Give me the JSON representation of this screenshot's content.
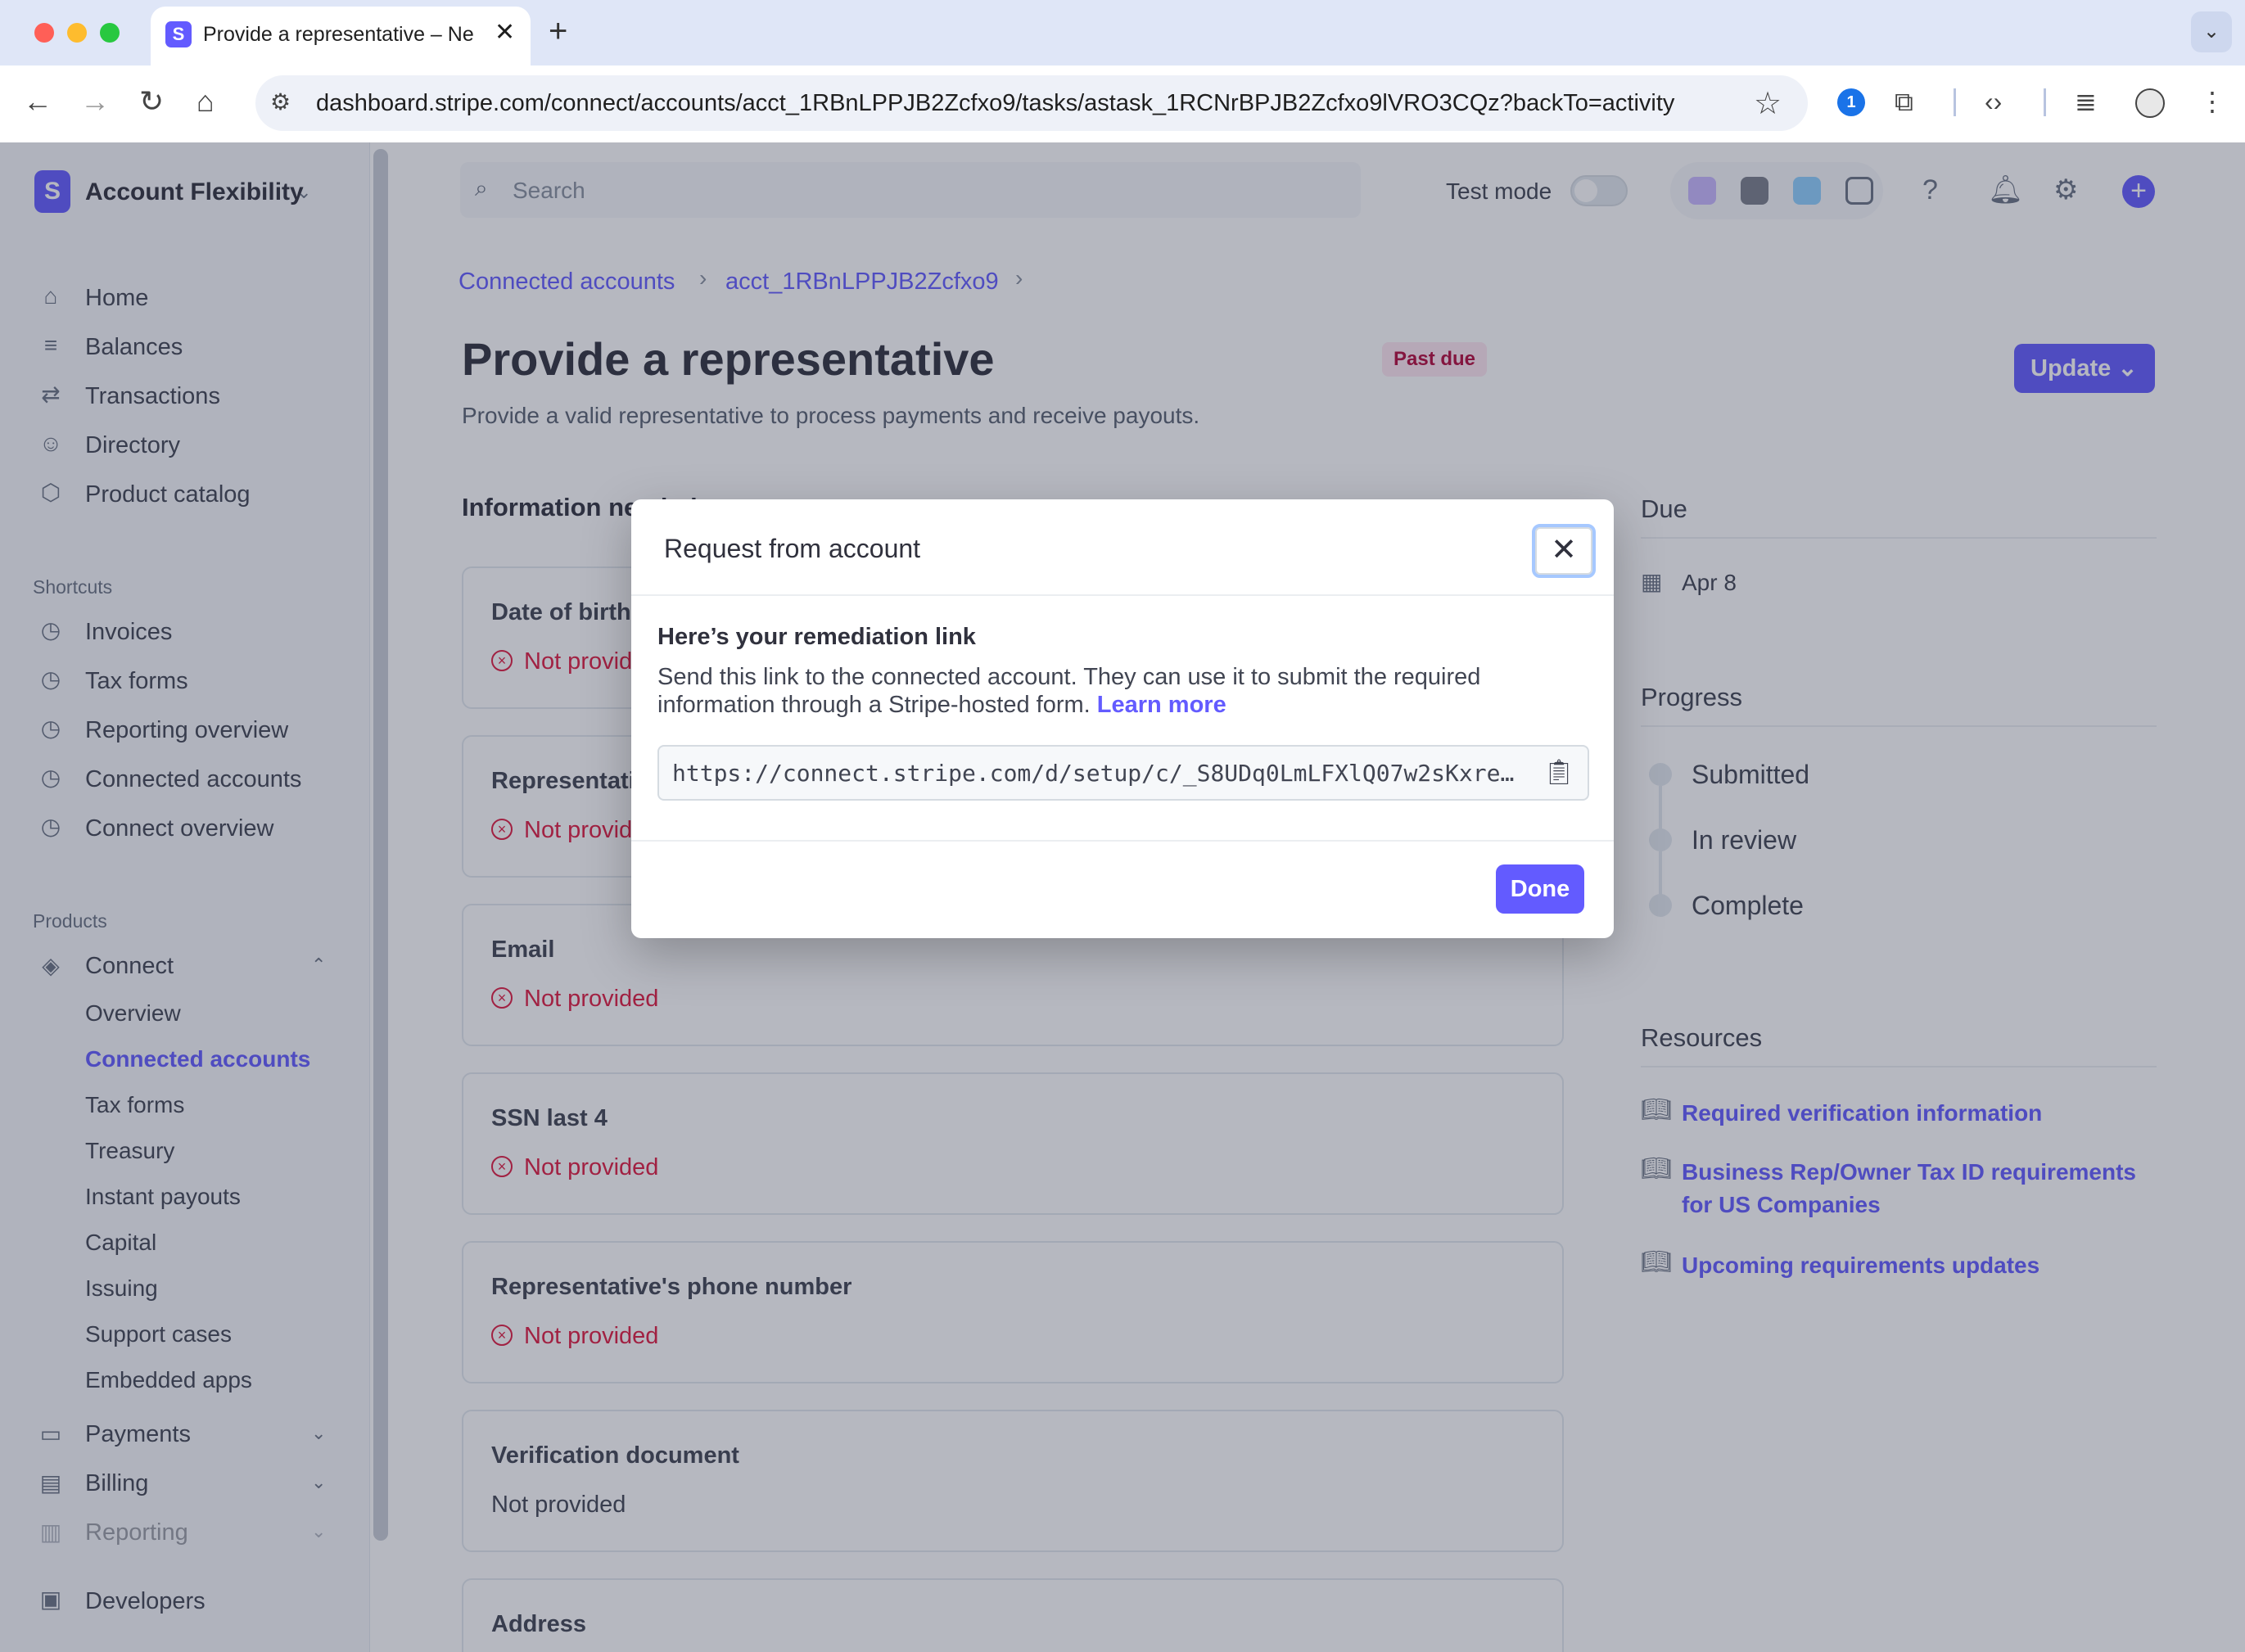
{
  "browser": {
    "tab_title": "Provide a representative – Ne",
    "tab_close": "✕",
    "new_tab": "+",
    "url": "dashboard.stripe.com/connect/accounts/acct_1RBnLPPJB2Zcfxo9/tasks/astask_1RCNrBPJB2Zcfxo9lVRO3CQz?backTo=activity",
    "favicon_letter": "S"
  },
  "sidebar": {
    "account_name": "Account Flexibility",
    "logo_letter": "S",
    "main_items": [
      {
        "label": "Home",
        "icon": "home-icon"
      },
      {
        "label": "Balances",
        "icon": "balances-icon"
      },
      {
        "label": "Transactions",
        "icon": "transactions-icon"
      },
      {
        "label": "Directory",
        "icon": "person-icon"
      },
      {
        "label": "Product catalog",
        "icon": "box-icon"
      }
    ],
    "shortcuts_label": "Shortcuts",
    "shortcuts": [
      {
        "label": "Invoices"
      },
      {
        "label": "Tax forms"
      },
      {
        "label": "Reporting overview"
      },
      {
        "label": "Connected accounts"
      },
      {
        "label": "Connect overview"
      }
    ],
    "products_label": "Products",
    "connect_label": "Connect",
    "connect_items": [
      {
        "label": "Overview"
      },
      {
        "label": "Connected accounts"
      },
      {
        "label": "Tax forms"
      },
      {
        "label": "Treasury"
      },
      {
        "label": "Instant payouts"
      },
      {
        "label": "Capital"
      },
      {
        "label": "Issuing"
      },
      {
        "label": "Support cases"
      },
      {
        "label": "Embedded apps"
      }
    ],
    "payments_label": "Payments",
    "billing_label": "Billing",
    "reporting_label": "Reporting",
    "developers_label": "Developers"
  },
  "header": {
    "search_placeholder": "Search",
    "test_mode_label": "Test mode"
  },
  "breadcrumb": {
    "items": [
      "Connected accounts",
      "acct_1RBnLPPJB2Zcfxo9"
    ]
  },
  "page": {
    "title": "Provide a representative",
    "badge": "Past due",
    "subtitle": "Provide a valid representative to process payments and receive payouts.",
    "update_button": "Update",
    "info_heading": "Information needed"
  },
  "cards": [
    {
      "label": "Date of birth",
      "status": "Not provided",
      "error": true
    },
    {
      "label": "Representative's name",
      "status": "Not provided",
      "error": true
    },
    {
      "label": "Email",
      "status": "Not provided",
      "error": true
    },
    {
      "label": "SSN last 4",
      "status": "Not provided",
      "error": true
    },
    {
      "label": "Representative's phone number",
      "status": "Not provided",
      "error": true
    },
    {
      "label": "Verification document",
      "status": "Not provided",
      "error": false
    },
    {
      "label": "Address",
      "status": "",
      "error": false
    }
  ],
  "right": {
    "due_heading": "Due",
    "due_date": "Apr 8",
    "progress_heading": "Progress",
    "progress_steps": [
      "Submitted",
      "In review",
      "Complete"
    ],
    "resources_heading": "Resources",
    "resources": [
      "Required verification information",
      "Business Rep/Owner Tax ID requirements for US Companies",
      "Upcoming requirements updates"
    ]
  },
  "modal": {
    "title": "Request from account",
    "close_label": "✕",
    "body_title": "Here’s your remediation link",
    "description": "Send this link to the connected account. They can use it to submit the required information through a Stripe-hosted form.",
    "learn_more": "Learn more",
    "link_value": "https://connect.stripe.com/d/setup/c/_S8UDq0LmLFXlQ07w2sKxre…",
    "done_button": "Done"
  },
  "colors": {
    "brand": "#635bff",
    "error": "#df1b41",
    "badge_bg": "#ffe7f2"
  }
}
